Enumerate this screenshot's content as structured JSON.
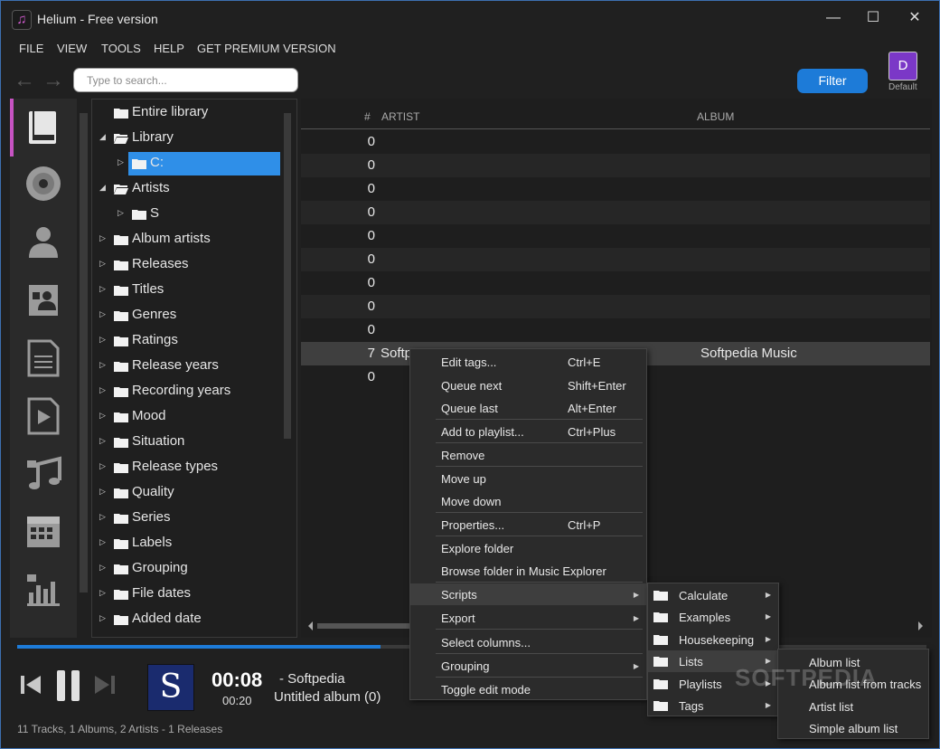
{
  "app": {
    "title": "Helium - Free version",
    "icon": "music-note-icon"
  },
  "window_controls": {
    "minimize": "—",
    "maximize": "☐",
    "close": "✕"
  },
  "menu": [
    "FILE",
    "VIEW",
    "TOOLS",
    "HELP",
    "GET PREMIUM VERSION"
  ],
  "toolbar": {
    "search_placeholder": "Type to search...",
    "filter_label": "Filter",
    "profile_initial": "D",
    "profile_label": "Default"
  },
  "tree": {
    "items": [
      {
        "label": "Entire library"
      },
      {
        "label": "Library"
      },
      {
        "label": "C:"
      },
      {
        "label": "Artists"
      },
      {
        "label": "S"
      },
      {
        "label": "Album artists"
      },
      {
        "label": "Releases"
      },
      {
        "label": "Titles"
      },
      {
        "label": "Genres"
      },
      {
        "label": "Ratings"
      },
      {
        "label": "Release years"
      },
      {
        "label": "Recording years"
      },
      {
        "label": "Mood"
      },
      {
        "label": "Situation"
      },
      {
        "label": "Release types"
      },
      {
        "label": "Quality"
      },
      {
        "label": "Series"
      },
      {
        "label": "Labels"
      },
      {
        "label": "Grouping"
      },
      {
        "label": "File dates"
      },
      {
        "label": "Added date"
      }
    ]
  },
  "table": {
    "columns": {
      "num": "#",
      "artist": "ARTIST",
      "album": "ALBUM"
    },
    "rows": [
      {
        "num": "0",
        "artist": "",
        "album": ""
      },
      {
        "num": "0",
        "artist": "",
        "album": ""
      },
      {
        "num": "0",
        "artist": "",
        "album": ""
      },
      {
        "num": "0",
        "artist": "",
        "album": ""
      },
      {
        "num": "0",
        "artist": "",
        "album": ""
      },
      {
        "num": "0",
        "artist": "",
        "album": ""
      },
      {
        "num": "0",
        "artist": "",
        "album": ""
      },
      {
        "num": "0",
        "artist": "",
        "album": ""
      },
      {
        "num": "0",
        "artist": "",
        "album": ""
      },
      {
        "num": "7",
        "artist": "Softp",
        "album": "Softpedia Music"
      },
      {
        "num": "0",
        "artist": "",
        "album": ""
      }
    ]
  },
  "context_menu": {
    "items": [
      {
        "label": "Edit tags...",
        "shortcut": "Ctrl+E"
      },
      {
        "label": "Queue next",
        "shortcut": "Shift+Enter"
      },
      {
        "label": "Queue last",
        "shortcut": "Alt+Enter"
      },
      {
        "label": "Add to playlist...",
        "shortcut": "Ctrl+Plus"
      },
      {
        "label": "Remove",
        "shortcut": ""
      },
      {
        "label": "Move up",
        "shortcut": ""
      },
      {
        "label": "Move down",
        "shortcut": ""
      },
      {
        "label": "Properties...",
        "shortcut": "Ctrl+P"
      },
      {
        "label": "Explore folder",
        "shortcut": ""
      },
      {
        "label": "Browse folder in Music Explorer",
        "shortcut": ""
      },
      {
        "label": "Scripts",
        "shortcut": ""
      },
      {
        "label": "Export",
        "shortcut": ""
      },
      {
        "label": "Select columns...",
        "shortcut": ""
      },
      {
        "label": "Grouping",
        "shortcut": ""
      },
      {
        "label": "Toggle edit mode",
        "shortcut": ""
      }
    ]
  },
  "scripts_menu": [
    "Calculate",
    "Examples",
    "Housekeeping",
    "Lists",
    "Playlists",
    "Tags"
  ],
  "lists_menu": [
    "Album list",
    "Album list from tracks",
    "Artist list",
    "Simple album list"
  ],
  "player": {
    "cover_letter": "S",
    "elapsed": "00:08",
    "duration": "00:20",
    "artist_line": "- Softpedia",
    "album_line": "Untitled album (0)",
    "progress": 0.4
  },
  "status": "11 Tracks, 1 Albums, 2 Artists - 1 Releases",
  "watermark": "SOFTPEDIA"
}
